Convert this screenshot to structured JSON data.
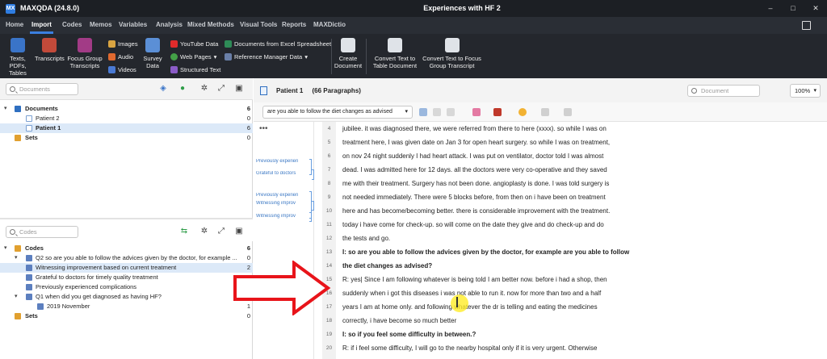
{
  "app": {
    "name": "MAXQDA (24.8.0)",
    "document_title": "Experiences with HF 2",
    "logo": "MX"
  },
  "menu_tabs": [
    "Home",
    "Import",
    "Codes",
    "Memos",
    "Variables",
    "Analysis",
    "Mixed Methods",
    "Visual Tools",
    "Reports",
    "MAXDictio"
  ],
  "active_tab": "Import",
  "ribbon": {
    "texts": "Texts, PDFs,\nTables",
    "transcripts": "Transcripts",
    "focus_group": "Focus Group\nTranscripts",
    "images": "Images",
    "audio": "Audio",
    "videos": "Videos",
    "survey": "Survey\nData",
    "youtube": "YouTube Data",
    "web_pages": "Web Pages",
    "structured_text": "Structured Text",
    "excel": "Documents from Excel Spreadsheet",
    "reference": "Reference Manager Data",
    "create_document": "Create\nDocument",
    "convert_table": "Convert Text to\nTable Document",
    "convert_focus": "Convert Text to Focus\nGroup Transcript"
  },
  "documents_pane": {
    "search_placeholder": "Documents",
    "items": [
      {
        "label": "Documents",
        "count": "6"
      },
      {
        "label": "Patient 2",
        "count": "0"
      },
      {
        "label": "Patient 1",
        "count": "6"
      },
      {
        "label": "Sets",
        "count": "0"
      }
    ]
  },
  "codes_pane": {
    "search_placeholder": "Codes",
    "items": [
      {
        "label": "Codes",
        "count": "6"
      },
      {
        "label": "Q2 so are you able to follow the advices given by the doctor, for example ...",
        "count": "0"
      },
      {
        "label": "Witnessing improvement based on current treatment",
        "count": "2"
      },
      {
        "label": "Grateful to doctors for timely quality treatment",
        "count": "1"
      },
      {
        "label": "Previously experienced complications",
        "count": "2"
      },
      {
        "label": "Q1 when did you get diagnosed as having HF?",
        "count": "0"
      },
      {
        "label": "2019 November",
        "count": "1"
      },
      {
        "label": "Sets",
        "count": "0"
      }
    ]
  },
  "document_browser": {
    "title": "Patient 1     (66 Paragraphs)",
    "search_placeholder": "Document",
    "zoom": "100%",
    "retrieval_dropdown": "are you able to follow the diet changes as advised",
    "code_labels": [
      "Previously experien",
      "Grateful to doctors",
      "Previously experien",
      "Witnessing improv",
      "Witnessing improv"
    ],
    "paragraphs": [
      {
        "n": "4",
        "text": "jubilee. it was diagnosed there, we were referred from there to here (xxxx). so while I was on",
        "bold": false
      },
      {
        "n": "5",
        "text": "treatment here, I was given date on Jan 3 for open heart surgery. so while I was on treatment,",
        "bold": false
      },
      {
        "n": "6",
        "text": "on nov 24 night suddenly I had heart attack. I was put on ventilator, doctor told I was almost",
        "bold": false
      },
      {
        "n": "7",
        "text": "dead. I was admitted here for 12 days. all the doctors were very co-operative and they saved",
        "bold": false
      },
      {
        "n": "8",
        "text": "me with their treatment. Surgery has not been done. angioplasty is done. I was told surgery is",
        "bold": false
      },
      {
        "n": "9",
        "text": "not needed immediately. There were 5 blocks before, from then on i have been on treatment",
        "bold": false
      },
      {
        "n": "10",
        "text": "here and has become/becoming better. there is considerable improvement with the treatment.",
        "bold": false
      },
      {
        "n": "11",
        "text": "today i have come for check-up. so will come on the date they give and do check-up and do",
        "bold": false
      },
      {
        "n": "12",
        "text": "the tests and go.",
        "bold": false
      },
      {
        "n": "13",
        "text": "I: so are you able to follow the advices given by the doctor, for example are you able to follow",
        "bold": true
      },
      {
        "n": "14",
        "text": "the diet changes as advised?",
        "bold": true
      },
      {
        "n": "15",
        "text": "R: yes| Since I am following whatever is being told I am better now. before i had a shop, then",
        "bold": false
      },
      {
        "n": "16",
        "text": "suddenly when i got this diseases i was not able to run it. now for more than two and a half",
        "bold": false
      },
      {
        "n": "17",
        "text": "years I am at home only. and following whatever the dr is telling and eating the medicines",
        "bold": false
      },
      {
        "n": "18",
        "text": "correctly, i have become so much better",
        "bold": false
      },
      {
        "n": "19",
        "text": "I: so if you feel some difficulty in between.?",
        "bold": true
      },
      {
        "n": "20",
        "text": "R: if i feel some difficulty, I will go to the nearby hospital only if it is very urgent. Otherwise",
        "bold": false
      }
    ]
  },
  "colors": {
    "titlebar": "#1c1f24",
    "ribbon": "#24272d",
    "accent": "#3b7fe0",
    "arrow": "#e8141a",
    "highlight": "#ffec28"
  }
}
